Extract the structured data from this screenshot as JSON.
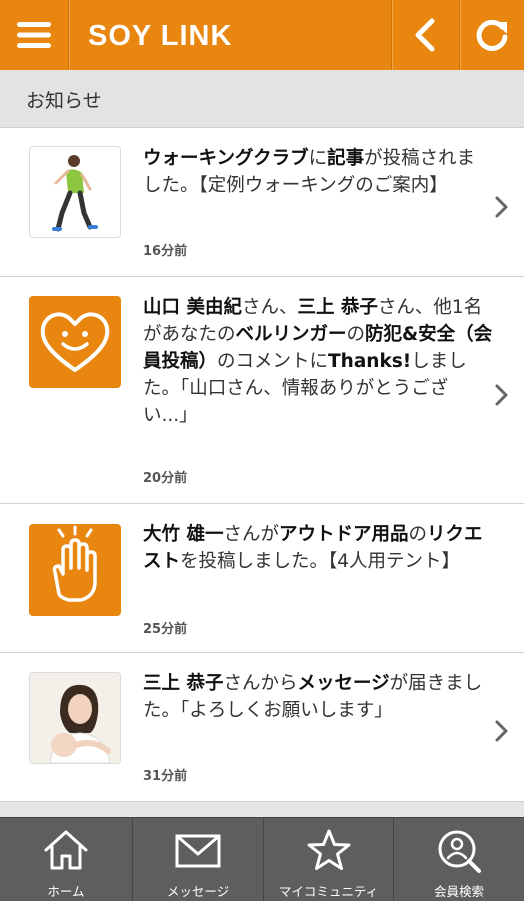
{
  "header": {
    "logo": "SOY LINK",
    "menu_icon": "hamburger-icon",
    "back_icon": "chevron-left-icon",
    "reload_icon": "reload-icon"
  },
  "section": {
    "title": "お知らせ"
  },
  "notifications": [
    {
      "thumb": "walking-woman-photo",
      "parts": [
        "ウォーキングクラブ",
        "に",
        "記事",
        "が投稿されました。【定例ウォーキングのご案内】"
      ],
      "time": "16分前"
    },
    {
      "thumb": "heart-face-icon",
      "parts": [
        "山口 美由紀",
        "さん、",
        "三上 恭子",
        "さん、他1名があなたの",
        "ベルリンガー",
        "の",
        "防犯&安全（会員投稿）",
        "のコメントに",
        "Thanks!",
        "しました。「山口さん、情報ありがとうござい...」"
      ],
      "time": "20分前"
    },
    {
      "thumb": "hand-raise-icon",
      "parts": [
        "大竹 雄一",
        "さんが",
        "アウトドア用品",
        "の",
        "リクエスト",
        "を投稿しました。【4人用テント】"
      ],
      "time": "25分前"
    },
    {
      "thumb": "mother-baby-photo",
      "parts": [
        "三上 恭子",
        "さんから",
        "メッセージ",
        "が届きました。「よろしくお願いします」"
      ],
      "time": "31分前"
    }
  ],
  "tabs": [
    {
      "label": "ホーム",
      "icon": "home-icon"
    },
    {
      "label": "メッセージ",
      "icon": "mail-icon"
    },
    {
      "label": "マイコミュニティ",
      "icon": "star-icon"
    },
    {
      "label": "会員検索",
      "icon": "member-search-icon"
    }
  ],
  "colors": {
    "accent": "#e8860f",
    "tabbar": "#5e5e5e"
  }
}
